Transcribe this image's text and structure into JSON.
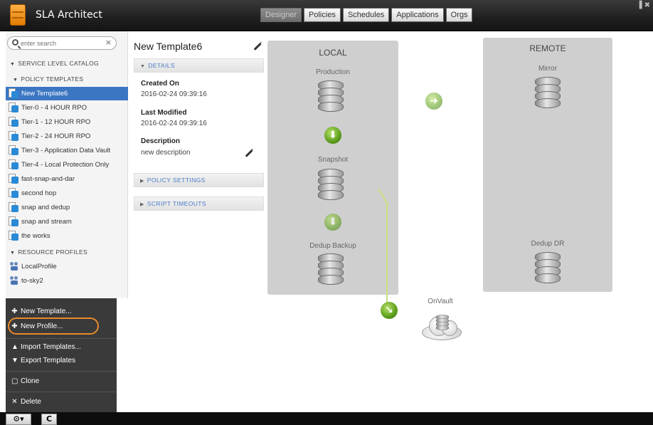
{
  "app": {
    "title": "SLA Architect"
  },
  "tabs": [
    "Designer",
    "Policies",
    "Schedules",
    "Applications",
    "Orgs"
  ],
  "window_controls": "▐ ✖",
  "search": {
    "placeholder": "enter search",
    "clear": "×"
  },
  "catalog": {
    "section_title": "SERVICE LEVEL CATALOG",
    "policy_templates_title": "POLICY TEMPLATES",
    "policy_templates": [
      "New Template6",
      "Tier-0 - 4 HOUR RPO",
      "Tier-1 - 12 HOUR RPO",
      "Tier-2 - 24 HOUR RPO",
      "Tier-3 - Application Data Vault",
      "Tier-4 - Local Protection Only",
      "fast-snap-and-dar",
      "second hop",
      "snap and dedup",
      "snap and stream",
      "the works"
    ],
    "resource_profiles_title": "RESOURCE PROFILES",
    "resource_profiles": [
      "LocalProfile",
      "to-sky2"
    ]
  },
  "actions": {
    "new_template": "New Template...",
    "new_profile": "New Profile...",
    "import_templates": "Import Templates...",
    "export_templates": "Export Templates",
    "clone": "Clone",
    "delete": "Delete"
  },
  "bottom": {
    "settings_label": "⚙▾",
    "refresh_label": "C"
  },
  "details": {
    "template_name": "New Template6",
    "details_header": "DETAILS",
    "created_on_label": "Created On",
    "created_on": "2016-02-24 09:39:16",
    "last_modified_label": "Last Modified",
    "last_modified": "2016-02-24 09:39:16",
    "description_label": "Description",
    "description": "new description",
    "policy_settings": "POLICY SETTINGS",
    "script_timeouts": "SCRIPT TIMEOUTS"
  },
  "canvas": {
    "local_label": "LOCAL",
    "remote_label": "REMOTE",
    "production": "Production",
    "snapshot": "Snapshot",
    "dedup_backup": "Dedup Backup",
    "mirror": "Mirror",
    "dedup_dr": "Dedup DR",
    "onvault": "OnVault"
  },
  "colors": {
    "selection": "#3b76c3",
    "highlight_ring": "#e88a2c",
    "flow_line": "#c8e07a"
  }
}
